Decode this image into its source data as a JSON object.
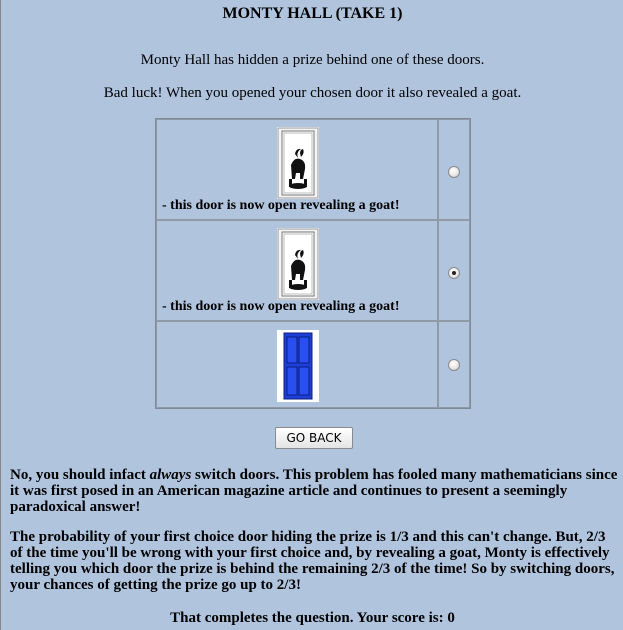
{
  "page": {
    "title": "MONTY HALL (TAKE 1)",
    "intro_line1": "Monty Hall has hidden a prize behind one of these doors.",
    "intro_line2": "Bad luck! When you opened your chosen door it also revealed a goat."
  },
  "doors": [
    {
      "icon": "goat-door-icon",
      "caption": "- this door is now open revealing a goat!",
      "selected": false
    },
    {
      "icon": "goat-door-icon",
      "caption": "- this door is now open revealing a goat!",
      "selected": true
    },
    {
      "icon": "closed-blue-door-icon",
      "caption": "",
      "selected": false
    }
  ],
  "actions": {
    "go_back_label": "GO BACK"
  },
  "explanation": {
    "para1_before": "No, you should infact ",
    "para1_emphasis": "always",
    "para1_after": " switch doors. This problem has fooled many mathematicians since it was first posed in an American magazine article and continues to present a seemingly paradoxical answer!",
    "para2": "The probability of your first choice door hiding the prize is 1/3 and this can't change. But, 2/3 of the time you'll be wrong with your first choice and, by revealing a goat, Monty is effectively telling you which door the prize is behind the remaining 2/3 of the time! So by switching doors, your chances of getting the prize go up to 2/3!",
    "score_line": "That completes the question. Your score is: 0"
  },
  "colors": {
    "background": "#b0c4de",
    "door_blue": "#1f3fd6"
  }
}
